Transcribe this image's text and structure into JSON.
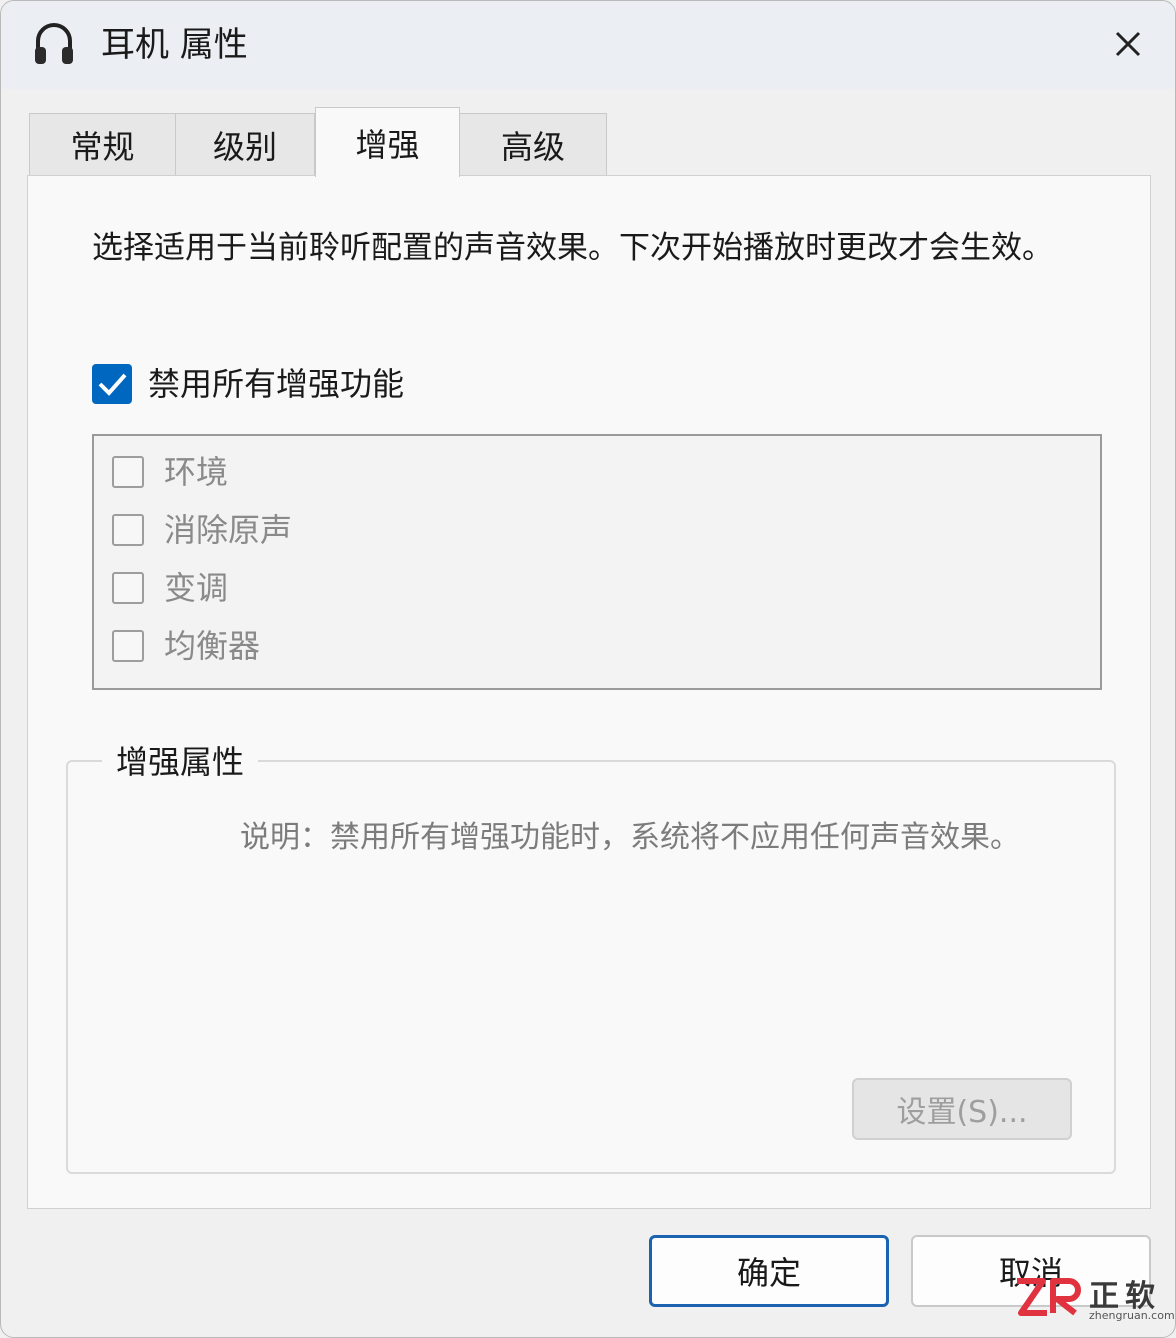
{
  "window": {
    "title": "耳机 属性",
    "icon": "headphones-icon",
    "close_icon": "close-icon"
  },
  "tabs": [
    {
      "label": "常规",
      "active": false
    },
    {
      "label": "级别",
      "active": false
    },
    {
      "label": "增强",
      "active": true
    },
    {
      "label": "高级",
      "active": false
    }
  ],
  "panel": {
    "description": "选择适用于当前聆听配置的声音效果。下次开始播放时更改才会生效。",
    "disable_all": {
      "label": "禁用所有增强功能",
      "checked": true
    },
    "effects": [
      {
        "label": "环境",
        "checked": false
      },
      {
        "label": "消除原声",
        "checked": false
      },
      {
        "label": "变调",
        "checked": false
      },
      {
        "label": "均衡器",
        "checked": false
      }
    ],
    "group": {
      "legend": "增强属性",
      "note": "说明：禁用所有增强功能时，系统将不应用任何声音效果。",
      "settings_button": "设置(S)..."
    }
  },
  "footer": {
    "ok_label": "确定",
    "cancel_label": "取消"
  },
  "watermark": {
    "logo_text": "ZR",
    "brand": "正软",
    "domain": "zhengruan.com"
  },
  "colors": {
    "accent": "#0067c0",
    "titlebar": "#ebeff3",
    "panel": "#f9f9f9",
    "disabled_text": "#8a8a8a"
  }
}
